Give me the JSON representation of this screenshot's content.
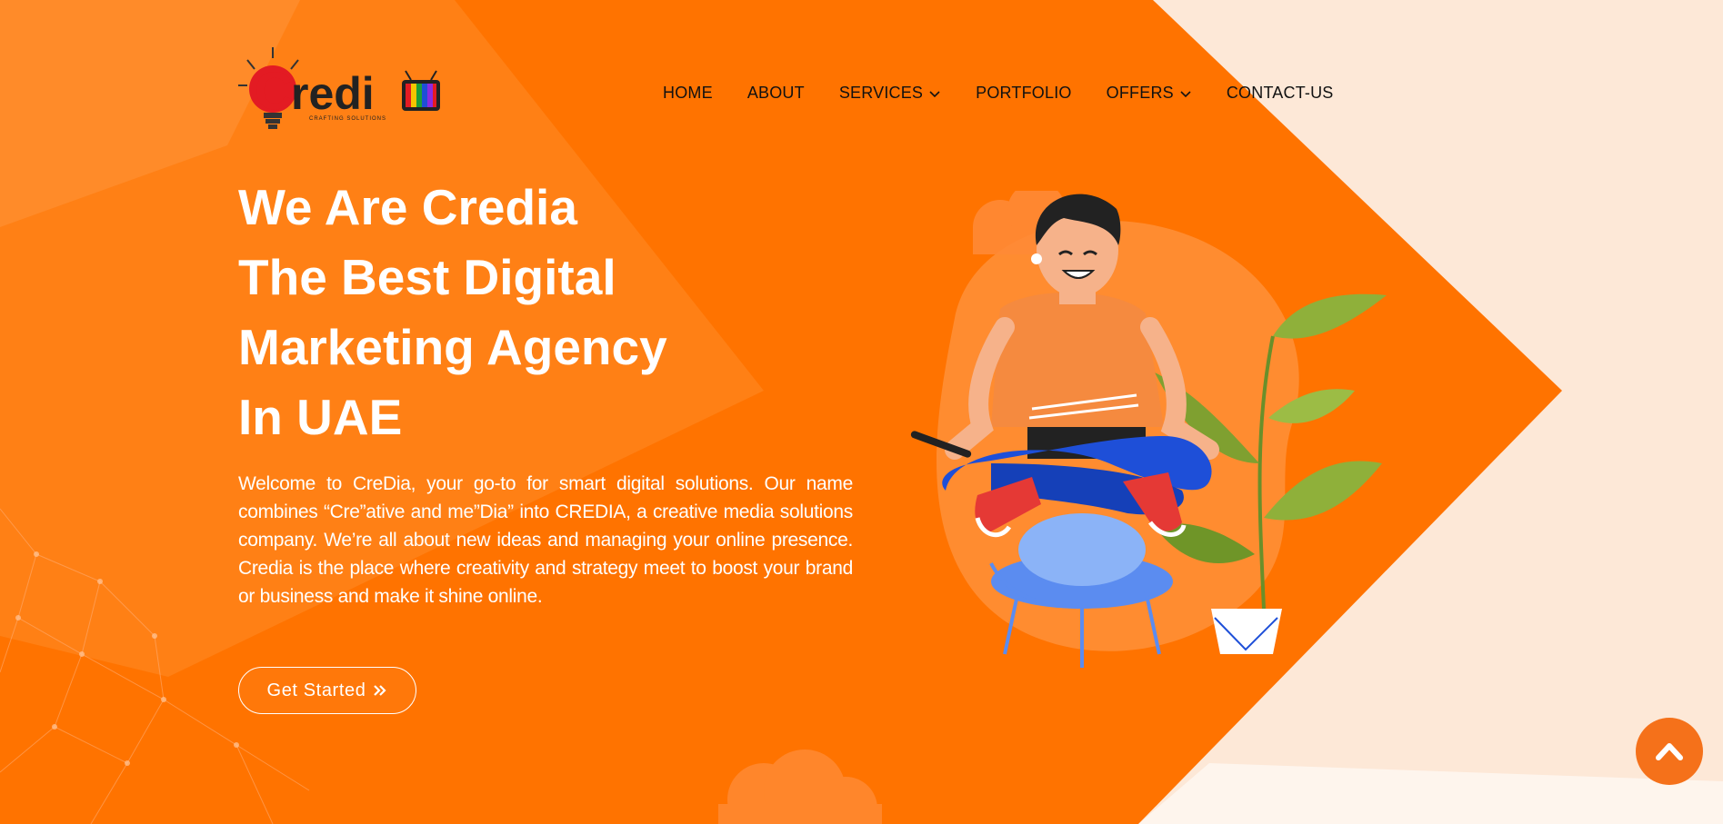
{
  "brand": {
    "logo_text": "Credia",
    "tagline": "CRAFTING SOLUTIONS",
    "logo_tv_icon": "tv-icon",
    "logo_bulb_icon": "lightbulb-icon"
  },
  "nav": {
    "items": [
      {
        "label": "HOME",
        "dropdown": false
      },
      {
        "label": "ABOUT",
        "dropdown": false
      },
      {
        "label": "SERVICES",
        "dropdown": true
      },
      {
        "label": "PORTFOLIO",
        "dropdown": false
      },
      {
        "label": "OFFERS",
        "dropdown": true
      },
      {
        "label": "CONTACT-US",
        "dropdown": false
      }
    ],
    "dropdown_icon": "chevron-down-icon"
  },
  "hero": {
    "headline": [
      "We Are Credia",
      "The Best Digital",
      "Marketing Agency",
      "In UAE"
    ],
    "intro": "Welcome to CreDia, your go-to for smart digital solutions. Our name combines “Cre”ative and me”Dia” into CREDIA, a creative media solutions company. We’re all about new ideas and managing your online presence. Credia is the place where creativity and strategy meet to boost your brand or business and make it shine online.",
    "cta_label": "Get Started",
    "cta_icon": "double-chevron-right-icon",
    "illustration": "meditating-man-with-phone-illustration"
  },
  "scroll_top": {
    "icon": "chevron-up-icon"
  },
  "colors": {
    "primary_orange": "#ff7300",
    "light_peach": "#fde8d7",
    "text_dark": "#111111",
    "text_light": "#ffffff",
    "shirt_orange": "#f58a3f",
    "pants_blue": "#1e4fd8"
  }
}
